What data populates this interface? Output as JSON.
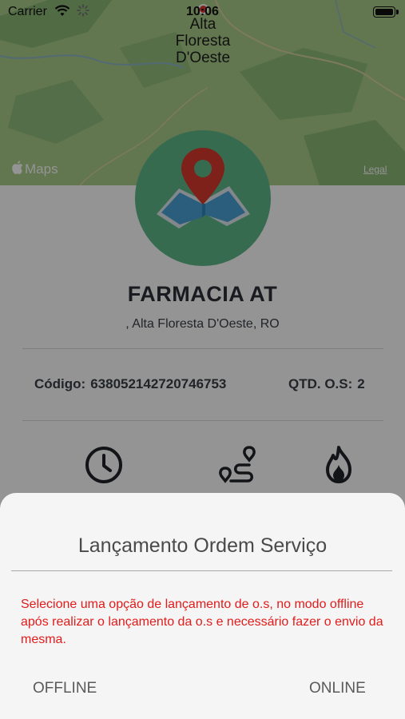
{
  "status_bar": {
    "carrier": "Carrier",
    "time": "10:06"
  },
  "map": {
    "city_name": "Alta\nFloresta\nD'Oeste",
    "provider_label": "Maps",
    "legal_link": "Legal"
  },
  "store": {
    "name": "FARMACIA AT",
    "address": ", Alta Floresta D'Oeste, RO",
    "code_label": "Código:",
    "code_value": "638052142720746753",
    "qtd_label": "QTD. O.S:",
    "qtd_value": "2"
  },
  "actions": {
    "icons": [
      "clock-icon",
      "route-icon",
      "fire-icon"
    ]
  },
  "dialog": {
    "title": "Lançamento Ordem Serviço",
    "message": "Selecione uma opção de lançamento de o.s, no modo offline após realizar o lançamento da o.s e necessário fazer o envio da mesma.",
    "offline_label": "OFFLINE",
    "online_label": "ONLINE"
  },
  "colors": {
    "map_green": "#a4c985",
    "emblem_green": "#60b98b",
    "pin_red": "#d9392f",
    "message_red": "#e21b1b"
  }
}
